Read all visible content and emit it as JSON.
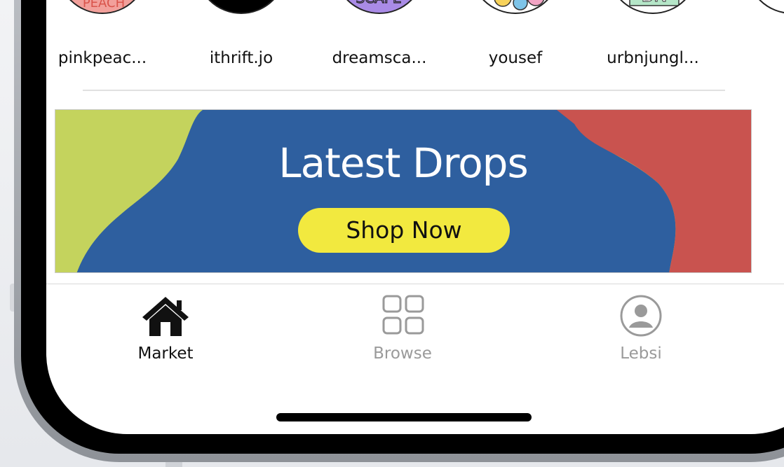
{
  "stories": [
    {
      "name": "pinkpeac...",
      "avatar_bg": "#f2a09b",
      "avatar_text": "PEACH"
    },
    {
      "name": "ithrift.jo",
      "avatar_bg": "#000000",
      "avatar_text": ""
    },
    {
      "name": "dreamsca...",
      "avatar_bg": "#a98be6",
      "avatar_text": "SCAPE"
    },
    {
      "name": "yousef",
      "avatar_bg": "#ffffff",
      "avatar_text": ""
    },
    {
      "name": "urbnjungl...",
      "avatar_bg": "#ffffff",
      "avatar_text": "BN"
    }
  ],
  "banner": {
    "title": "Latest Drops",
    "button_label": "Shop Now",
    "colors": {
      "green": "#c4d35d",
      "blue": "#2e5f9f",
      "red": "#c9534f",
      "button": "#f2e93f"
    }
  },
  "tabs": [
    {
      "label": "Market",
      "icon": "home-icon",
      "active": true
    },
    {
      "label": "Browse",
      "icon": "grid-icon",
      "active": false
    },
    {
      "label": "Lebsi",
      "icon": "profile-icon",
      "active": false
    }
  ],
  "colors": {
    "active_tab": "#111111",
    "inactive_tab": "#9a9a9a"
  }
}
